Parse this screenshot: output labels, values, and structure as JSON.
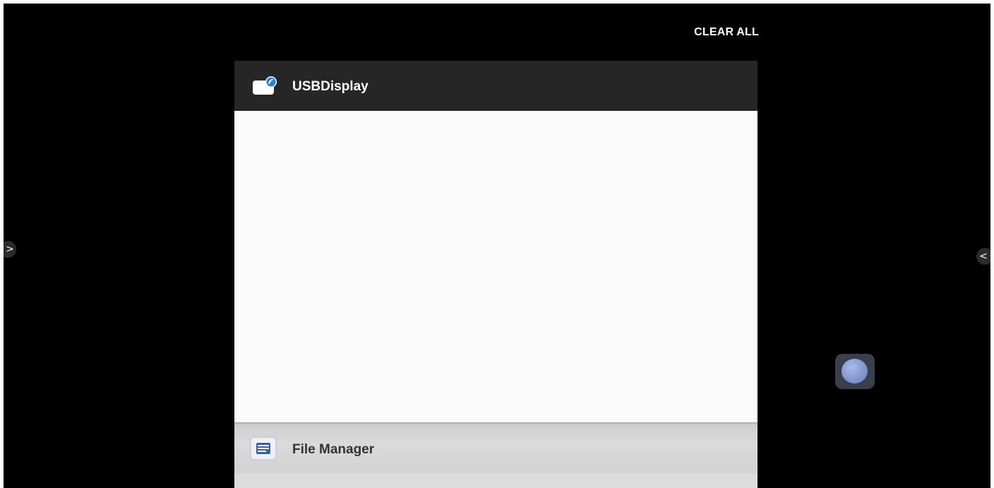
{
  "toolbar": {
    "clear_all_label": "CLEAR ALL"
  },
  "recent_apps": [
    {
      "title": "USBDisplay",
      "icon": "usb-display-icon"
    },
    {
      "title": "File Manager",
      "icon": "file-manager-icon"
    }
  ],
  "edge_handles": {
    "left_glyph": ">",
    "right_glyph": "<"
  },
  "floating_button": {
    "icon": "floating-ball-icon"
  },
  "colors": {
    "background": "#000000",
    "card_header": "#262626",
    "card_body": "#f9f9f9",
    "second_card": "#d6d6d6",
    "float_ball": "#8094cc"
  }
}
